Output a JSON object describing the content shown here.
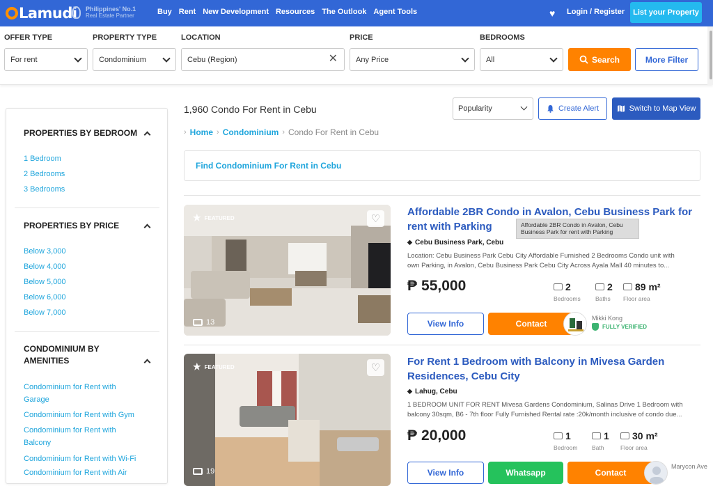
{
  "header": {
    "logo_text": "Lamudi",
    "partner_line1": "Philippines' No.1",
    "partner_line2": "Real Estate Partner",
    "nav": [
      "Buy",
      "Rent",
      "New Development",
      "Resources",
      "The Outlook",
      "Agent Tools"
    ],
    "login": "Login / Register",
    "list_property": "List your Property"
  },
  "filters": {
    "offer_type": {
      "label": "OFFER TYPE",
      "value": "For rent"
    },
    "property_type": {
      "label": "PROPERTY TYPE",
      "value": "Condominium"
    },
    "location": {
      "label": "LOCATION",
      "value": "Cebu (Region)"
    },
    "price": {
      "label": "PRICE",
      "value": "Any Price"
    },
    "bedrooms": {
      "label": "BEDROOMS",
      "value": "All"
    },
    "search": "Search",
    "more": "More Filter"
  },
  "sidebar": {
    "bedroom": {
      "title": "PROPERTIES BY BEDROOM",
      "links": [
        "1 Bedroom",
        "2 Bedrooms",
        "3 Bedrooms"
      ]
    },
    "price": {
      "title": "PROPERTIES BY PRICE",
      "links": [
        "Below 3,000",
        "Below 4,000",
        "Below 5,000",
        "Below 6,000",
        "Below 7,000"
      ]
    },
    "amenities": {
      "title_line1": "CONDOMINIUM BY",
      "title_line2": "AMENITIES",
      "links": [
        [
          "Condominium for Rent with",
          "Garage"
        ],
        [
          "Condominium for Rent with Gym"
        ],
        [
          "Condominium for Rent with",
          "Balcony"
        ],
        [
          "Condominium for Rent with Wi-Fi"
        ],
        [
          "Condominium for Rent with Air"
        ]
      ]
    }
  },
  "results": {
    "count": "1,960",
    "count_text": "Condo For Rent in Cebu",
    "sort": "Popularity",
    "create_alert": "Create Alert",
    "map_view": "Switch to Map View",
    "breadcrumb": [
      "Home",
      "Condominium",
      "Condo For Rent in Cebu"
    ],
    "find_link": "Find Condominium For Rent in Cebu"
  },
  "listings": [
    {
      "featured": "FEATURED",
      "photos": "13",
      "title_line1": "Affordable 2BR Condo in Avalon, Cebu Business Park for",
      "title_line2": "rent with Parking",
      "tooltip": "Affordable 2BR Condo in Avalon, Cebu Business Park for rent with Parking",
      "location": "Cebu Business Park, Cebu",
      "desc_line1": "Location: Cebu Business Park Cebu City Affordable Furnished 2 Bedrooms Condo unit with",
      "desc_line2": "own Parking, in Avalon, Cebu Business Park Cebu City Across Ayala Mall 40 minutes to...",
      "price": "55,000",
      "bedrooms": "2",
      "bedrooms_label": "Bedrooms",
      "baths": "2",
      "baths_label": "Baths",
      "area": "89 m²",
      "area_label": "Floor area",
      "view": "View Info",
      "contact": "Contact",
      "agent": "Mikki Kong",
      "verified": "FULLY VERIFIED"
    },
    {
      "featured": "FEATURED",
      "photos": "19",
      "title_line1": "For Rent 1 Bedroom with Balcony in Mivesa Garden",
      "title_line2": "Residences, Cebu City",
      "location": "Lahug, Cebu",
      "desc_line1": "1 BEDROOM UNIT FOR RENT Mivesa Gardens Condominium, Salinas Drive 1 Bedroom with",
      "desc_line2": "balcony 30sqm, B6 - 7th floor Fully Furnished Rental rate :20k/month inclusive of condo due...",
      "price": "20,000",
      "bedrooms": "1",
      "bedrooms_label": "Bedroom",
      "baths": "1",
      "baths_label": "Bath",
      "area": "30 m²",
      "area_label": "Floor area",
      "view": "View Info",
      "whatsapp": "Whatsapp",
      "contact": "Contact",
      "agent": "Marycon Ave"
    }
  ],
  "colors": {
    "brand_blue": "#3267d6",
    "accent_orange": "#ff8200",
    "link_cyan": "#1ea5dc",
    "whatsapp_green": "#25c25c"
  }
}
